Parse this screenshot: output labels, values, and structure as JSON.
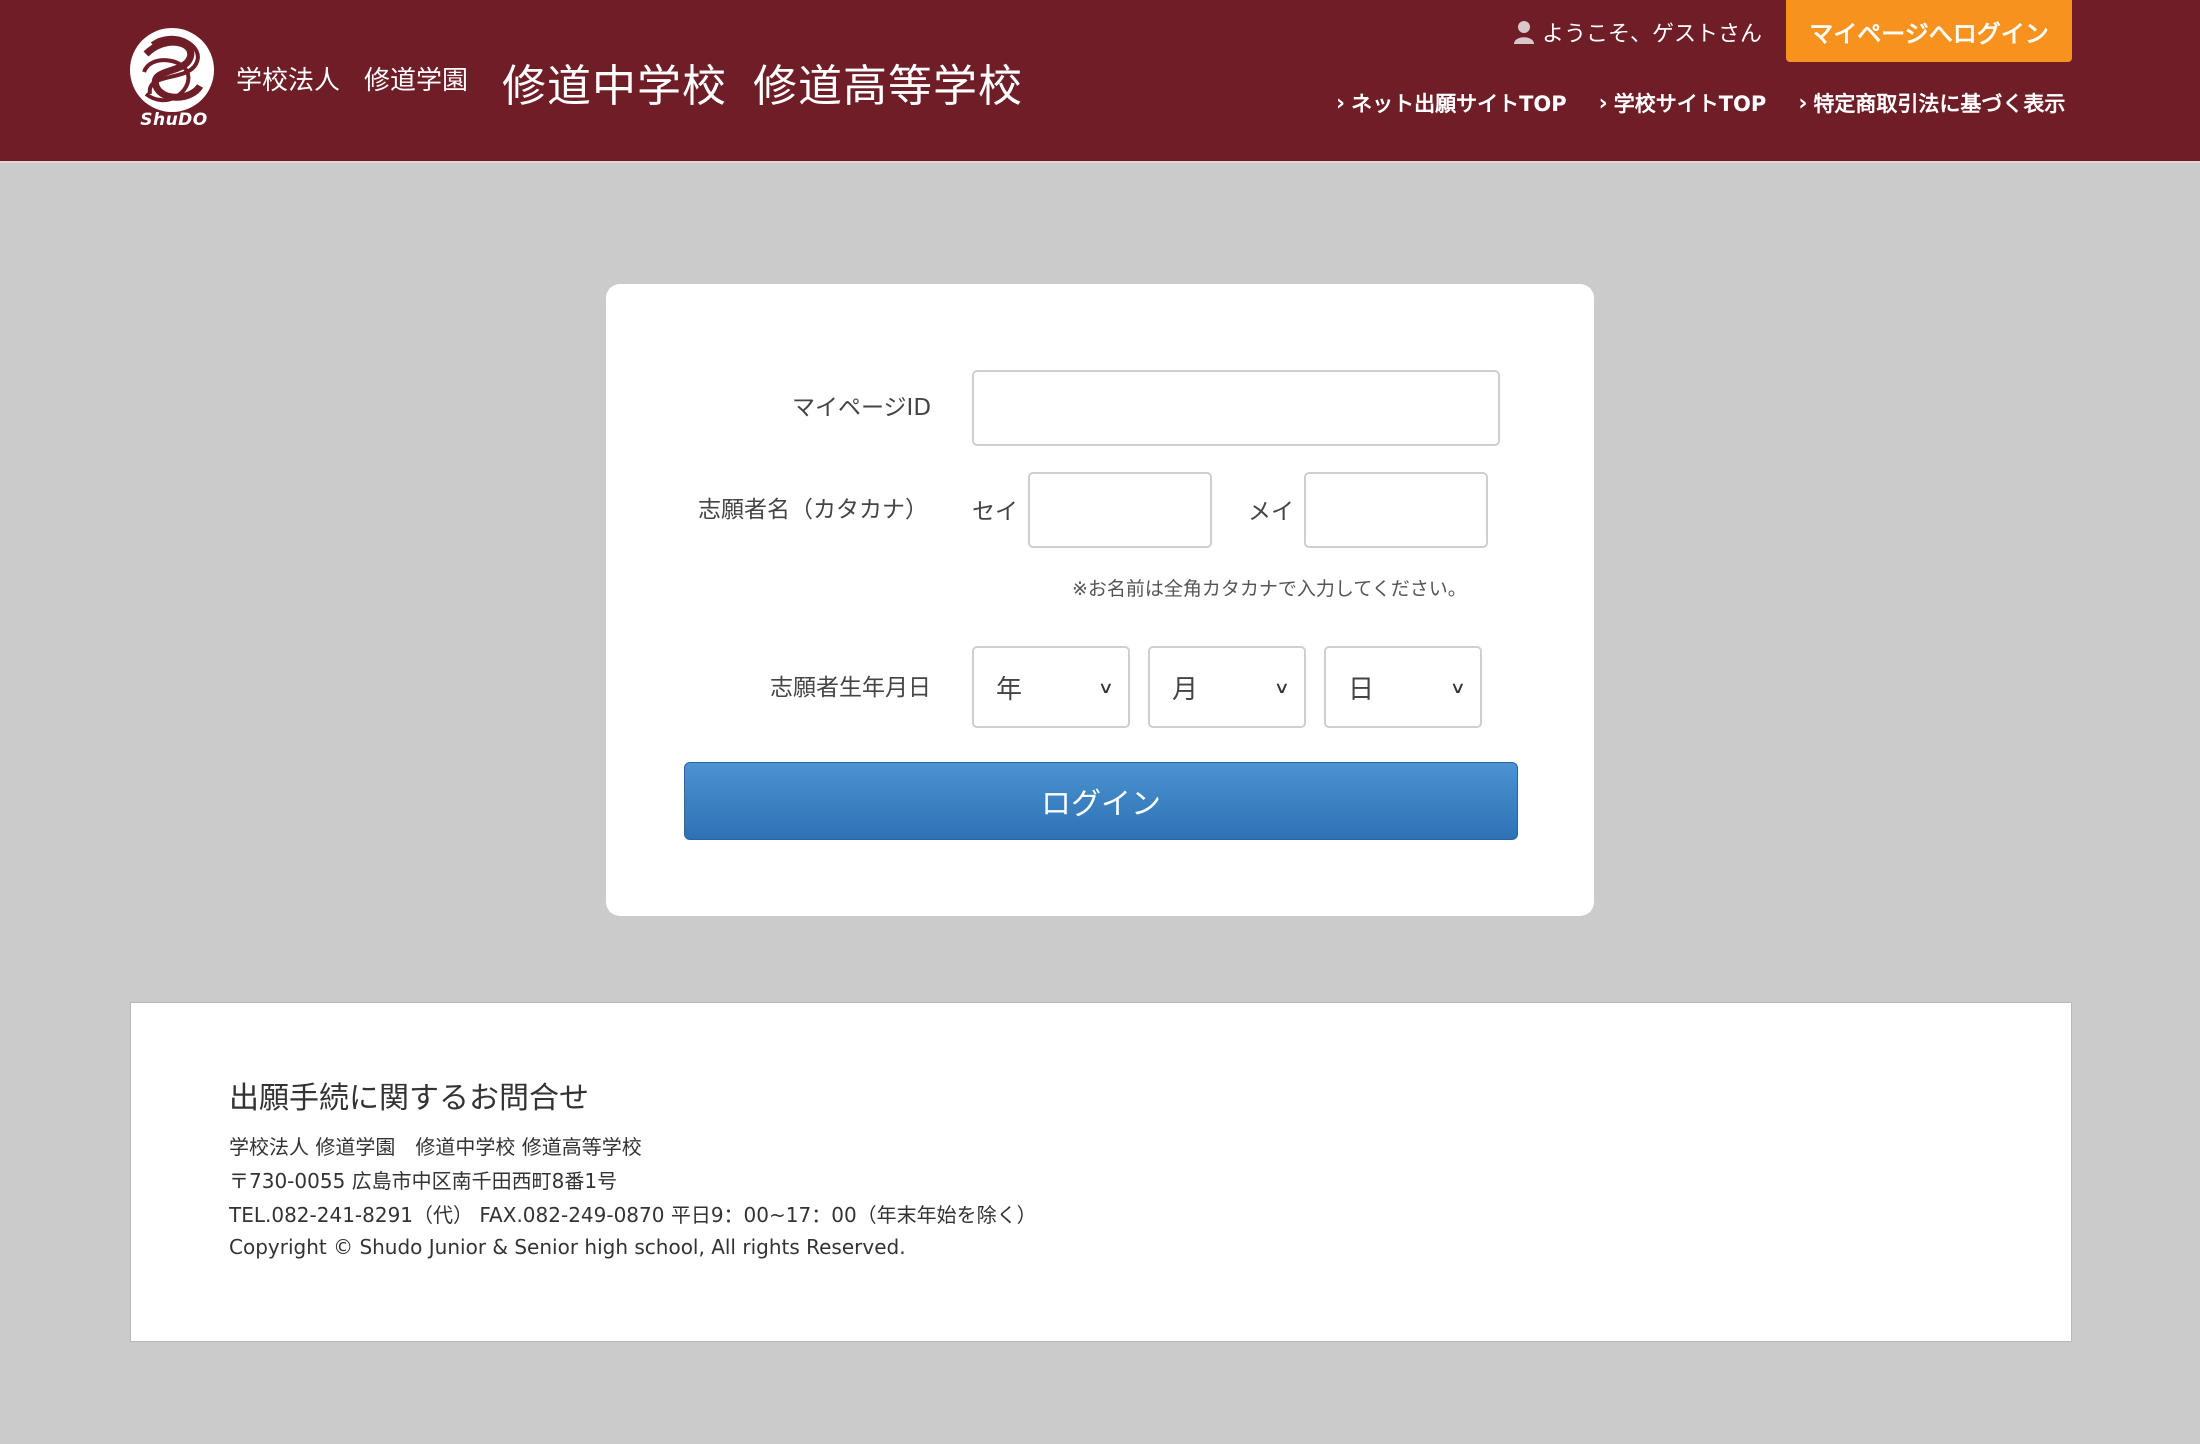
{
  "header": {
    "logo_text": "ShuDO",
    "school_org_1": "学校法人",
    "school_org_2": "修道学園",
    "school_main_1": "修道中学校",
    "school_main_2": "修道高等学校",
    "welcome_text": "ようこそ、ゲストさん",
    "login_button": "マイページへログイン",
    "nav": [
      {
        "label": "ネット出願サイトTOP"
      },
      {
        "label": "学校サイトTOP"
      },
      {
        "label": "特定商取引法に基づく表示"
      }
    ],
    "colors": {
      "header_bg": "#6f1d27",
      "login_button_bg": "#f7921e"
    }
  },
  "form": {
    "mypage_id_label": "マイページID",
    "mypage_id_value": "",
    "name_label": "志願者名（カタカナ）",
    "sei_label": "セイ",
    "sei_value": "",
    "mei_label": "メイ",
    "mei_value": "",
    "name_note": "※お名前は全角カタカナで入力してください。",
    "birth_label": "志願者生年月日",
    "year_selected": "年",
    "month_selected": "月",
    "day_selected": "日",
    "submit_label": "ログイン",
    "submit_color": "#3a82c4"
  },
  "footer": {
    "title": "出願手続に関するお問合せ",
    "lines": [
      "学校法人 修道学園　修道中学校 修道高等学校",
      "〒730-0055 広島市中区南千田西町8番1号",
      "TEL.082-241-8291（代） FAX.082-249-0870 平日9：00~17：00（年末年始を除く）",
      "Copyright © Shudo Junior & Senior high school, All rights Reserved."
    ]
  }
}
